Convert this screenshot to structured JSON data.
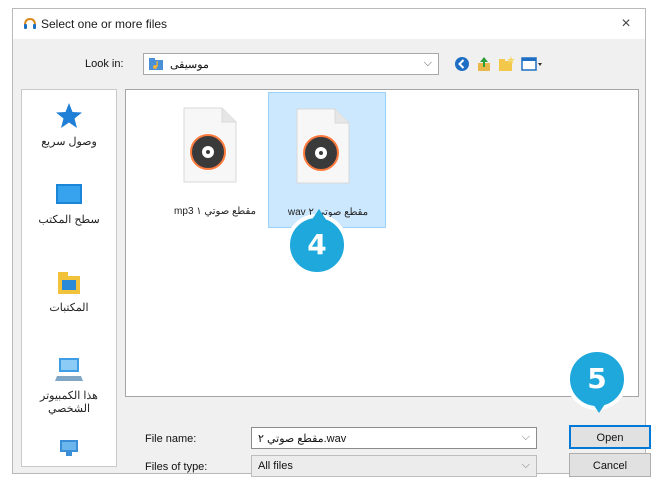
{
  "dialog": {
    "title": "Select one or more files",
    "close_label": "×"
  },
  "toolbar": {
    "look_in_label": "Look in:",
    "look_in_value": "موسيقى",
    "icons": [
      "back-icon",
      "up-folder-icon",
      "new-folder-icon",
      "view-menu-icon"
    ]
  },
  "places": [
    {
      "label": "وصول سريع",
      "icon": "star-icon"
    },
    {
      "label": "سطح المكتب",
      "icon": "desktop-icon"
    },
    {
      "label": "المكتبات",
      "icon": "libraries-icon"
    },
    {
      "label": "هذا الكمبيوتر الشخصي",
      "icon": "computer-icon"
    },
    {
      "label": "",
      "icon": "network-icon"
    }
  ],
  "files": [
    {
      "name": "mp3 مقطع صوتي ١",
      "icon": "audio-file-icon",
      "selected": false
    },
    {
      "name": "wav مقطع صوتي ٢",
      "icon": "audio-file-icon",
      "selected": true
    }
  ],
  "footer": {
    "file_name_label": "File name:",
    "file_name_value": "مقطع صوتي ٢.wav",
    "files_of_type_label": "Files of type:",
    "files_of_type_value": "All files",
    "open_label": "Open",
    "cancel_label": "Cancel"
  },
  "callouts": {
    "step4": "4",
    "step5": "5"
  },
  "colors": {
    "accent": "#0078d7",
    "selection": "#cce8ff",
    "callout": "#1ea8dc"
  }
}
